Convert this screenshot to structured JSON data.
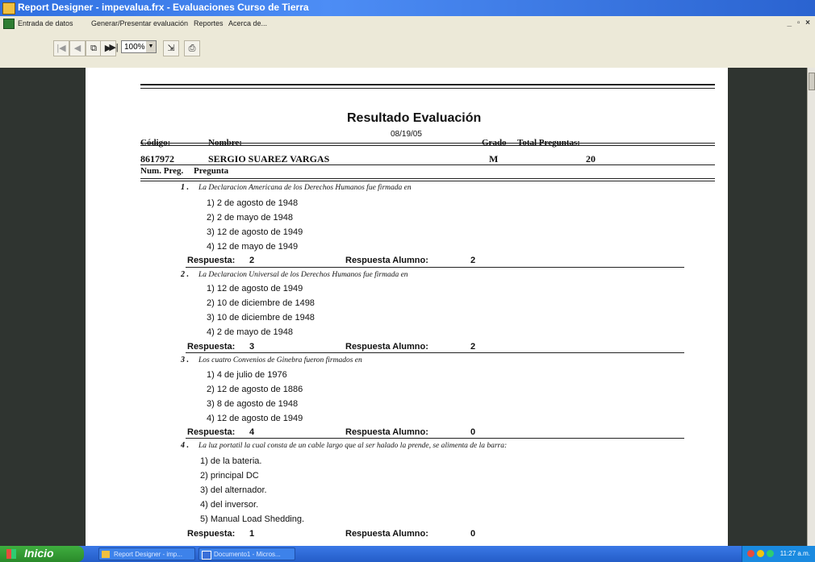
{
  "window": {
    "title": "Report Designer - impevalua.frx - Evaluaciones Curso de Tierra",
    "controls": "_ ▫ ×"
  },
  "menu": [
    "Entrada de datos",
    "Generar/Presentar evaluación",
    "Reportes",
    "Acerca de..."
  ],
  "toolbar": {
    "zoom": "100%"
  },
  "report": {
    "title": "Resultado Evaluación",
    "date": "08/19/05",
    "header_labels": {
      "codigo": "Código:",
      "nombre": "Nombre:",
      "grado": "Grado",
      "total": "Total Preguntas:"
    },
    "student": {
      "codigo": "8617972",
      "nombre": "SERGIO SUAREZ VARGAS",
      "grado": "M",
      "total": "20"
    },
    "columns": {
      "num": "Num. Preg.",
      "pregunta": "Pregunta"
    },
    "answer_label": "Respuesta:",
    "student_answer_label": "Respuesta Alumno:",
    "questions": [
      {
        "num": "1 .",
        "text": "La Declaracion Americana de los Derechos Humanos fue firmada en",
        "options": [
          "1) 2 de agosto de 1948",
          "2) 2 de mayo de 1948",
          "3) 12 de agosto de 1949",
          "4) 12 de mayo de 1949"
        ],
        "answer": "2",
        "student_answer": "2"
      },
      {
        "num": "2 .",
        "text": "La Declaracion Universal de los Derechos Humanos fue firmada en",
        "options": [
          "1) 12 de agosto de 1949",
          "2) 10 de diciembre de 1498",
          "3) 10 de diciembre de 1948",
          "4) 2 de mayo de 1948"
        ],
        "answer": "3",
        "student_answer": "2"
      },
      {
        "num": "3 .",
        "text": "Los cuatro Convenios de Ginebra fueron firmados en",
        "options": [
          "1) 4 de julio de 1976",
          "2) 12 de agosto de 1886",
          "3) 8 de agosto de 1948",
          "4) 12 de agosto de 1949"
        ],
        "answer": "4",
        "student_answer": "0"
      },
      {
        "num": "4 .",
        "text": "La luz portatil la cual consta de un cable largo que al ser halado la prende, se alimenta de la barra:",
        "options": [
          "1) de la bateria.",
          "2) principal DC",
          "3) del alternador.",
          "4) del inversor.",
          "5) Manual Load Shedding."
        ],
        "answer": "1",
        "student_answer": "0"
      }
    ]
  },
  "taskbar": {
    "start": "Inicio",
    "tasks": [
      "Report Designer - imp...",
      "Documento1 - Micros..."
    ],
    "clock": "11:27 a.m."
  }
}
